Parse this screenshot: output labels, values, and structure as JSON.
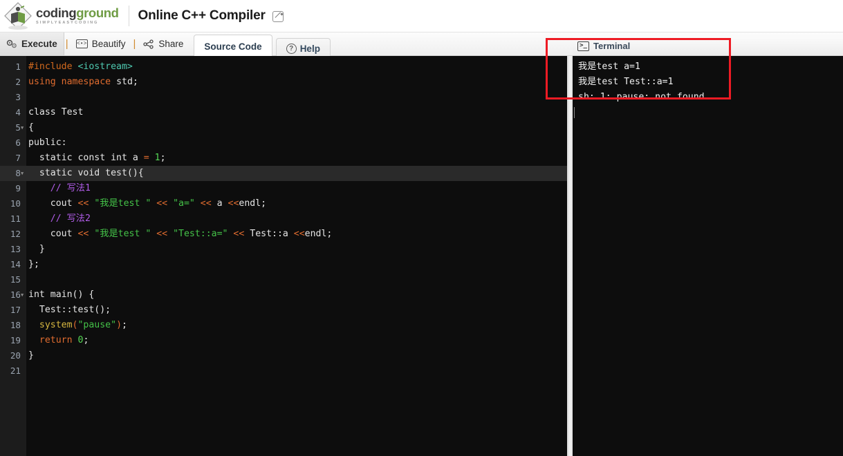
{
  "header": {
    "logo_main_part1": "coding",
    "logo_main_part2": "ground",
    "logo_tagline": "SIMPLYEASYCODING",
    "app_title": "Online C++ Compiler",
    "edit_icon": "pencil-edit-icon"
  },
  "toolbar": {
    "execute_label": "Execute",
    "execute_icon": "gears-icon",
    "separator": "|",
    "beautify_label": "Beautify",
    "beautify_icon": "monitor-code-icon",
    "share_label": "Share",
    "share_icon": "share-nodes-icon",
    "tabs": [
      {
        "label": "Source Code",
        "active": true,
        "icon": ""
      },
      {
        "label": "Help",
        "active": false,
        "icon": "question-circle-icon"
      }
    ],
    "help_glyph": "?"
  },
  "editor": {
    "language": "cpp",
    "active_line": 8,
    "lines": [
      {
        "n": "1",
        "fold": false,
        "tokens": [
          {
            "t": "#include ",
            "c": "t-pre"
          },
          {
            "t": "<iostream>",
            "c": "t-inc"
          }
        ]
      },
      {
        "n": "2",
        "fold": false,
        "tokens": [
          {
            "t": "using",
            "c": "t-kw"
          },
          {
            "t": " ",
            "c": "t-plain"
          },
          {
            "t": "namespace",
            "c": "t-kw"
          },
          {
            "t": " std;",
            "c": "t-plain"
          }
        ]
      },
      {
        "n": "3",
        "fold": false,
        "tokens": []
      },
      {
        "n": "4",
        "fold": false,
        "tokens": [
          {
            "t": "class Test",
            "c": "t-plain"
          }
        ]
      },
      {
        "n": "5",
        "fold": true,
        "tokens": [
          {
            "t": "{",
            "c": "t-plain"
          }
        ]
      },
      {
        "n": "6",
        "fold": false,
        "tokens": [
          {
            "t": "public:",
            "c": "t-plain"
          }
        ]
      },
      {
        "n": "7",
        "fold": false,
        "tokens": [
          {
            "t": "  static const int a ",
            "c": "t-plain"
          },
          {
            "t": "=",
            "c": "t-op"
          },
          {
            "t": " ",
            "c": "t-plain"
          },
          {
            "t": "1",
            "c": "t-num"
          },
          {
            "t": ";",
            "c": "t-plain"
          }
        ]
      },
      {
        "n": "8",
        "fold": true,
        "tokens": [
          {
            "t": "  static void test(){",
            "c": "t-plain"
          }
        ]
      },
      {
        "n": "9",
        "fold": false,
        "tokens": [
          {
            "t": "    // 写法1",
            "c": "t-com"
          }
        ]
      },
      {
        "n": "10",
        "fold": false,
        "tokens": [
          {
            "t": "    cout ",
            "c": "t-plain"
          },
          {
            "t": "<<",
            "c": "t-op"
          },
          {
            "t": " ",
            "c": "t-plain"
          },
          {
            "t": "\"我是test \"",
            "c": "t-str"
          },
          {
            "t": " ",
            "c": "t-plain"
          },
          {
            "t": "<<",
            "c": "t-op"
          },
          {
            "t": " ",
            "c": "t-plain"
          },
          {
            "t": "\"a=\"",
            "c": "t-str"
          },
          {
            "t": " ",
            "c": "t-plain"
          },
          {
            "t": "<<",
            "c": "t-op"
          },
          {
            "t": " a ",
            "c": "t-plain"
          },
          {
            "t": "<<",
            "c": "t-op"
          },
          {
            "t": "endl;",
            "c": "t-plain"
          }
        ]
      },
      {
        "n": "11",
        "fold": false,
        "tokens": [
          {
            "t": "    // 写法2",
            "c": "t-com"
          }
        ]
      },
      {
        "n": "12",
        "fold": false,
        "tokens": [
          {
            "t": "    cout ",
            "c": "t-plain"
          },
          {
            "t": "<<",
            "c": "t-op"
          },
          {
            "t": " ",
            "c": "t-plain"
          },
          {
            "t": "\"我是test \"",
            "c": "t-str"
          },
          {
            "t": " ",
            "c": "t-plain"
          },
          {
            "t": "<<",
            "c": "t-op"
          },
          {
            "t": " ",
            "c": "t-plain"
          },
          {
            "t": "\"Test::a=\"",
            "c": "t-str"
          },
          {
            "t": " ",
            "c": "t-plain"
          },
          {
            "t": "<<",
            "c": "t-op"
          },
          {
            "t": " Test::a ",
            "c": "t-plain"
          },
          {
            "t": "<<",
            "c": "t-op"
          },
          {
            "t": "endl;",
            "c": "t-plain"
          }
        ]
      },
      {
        "n": "13",
        "fold": false,
        "tokens": [
          {
            "t": "  }",
            "c": "t-plain"
          }
        ]
      },
      {
        "n": "14",
        "fold": false,
        "tokens": [
          {
            "t": "};",
            "c": "t-plain"
          }
        ]
      },
      {
        "n": "15",
        "fold": false,
        "tokens": []
      },
      {
        "n": "16",
        "fold": true,
        "tokens": [
          {
            "t": "int main() {",
            "c": "t-plain"
          }
        ]
      },
      {
        "n": "17",
        "fold": false,
        "tokens": [
          {
            "t": "  Test::test();",
            "c": "t-plain"
          }
        ]
      },
      {
        "n": "18",
        "fold": false,
        "tokens": [
          {
            "t": "  ",
            "c": "t-plain"
          },
          {
            "t": "system",
            "c": "t-fn"
          },
          {
            "t": "(",
            "c": "t-op"
          },
          {
            "t": "\"pause\"",
            "c": "t-str"
          },
          {
            "t": ")",
            "c": "t-op"
          },
          {
            "t": ";",
            "c": "t-plain"
          }
        ]
      },
      {
        "n": "19",
        "fold": false,
        "tokens": [
          {
            "t": "  ",
            "c": "t-plain"
          },
          {
            "t": "return",
            "c": "t-kw"
          },
          {
            "t": " ",
            "c": "t-plain"
          },
          {
            "t": "0",
            "c": "t-num"
          },
          {
            "t": ";",
            "c": "t-plain"
          }
        ]
      },
      {
        "n": "20",
        "fold": false,
        "tokens": [
          {
            "t": "}",
            "c": "t-plain"
          }
        ]
      },
      {
        "n": "21",
        "fold": false,
        "tokens": []
      }
    ]
  },
  "terminal": {
    "title": "Terminal",
    "icon": "terminal-prompt-icon",
    "icon_glyph": ">_",
    "output": "我是test a=1\n我是test Test::a=1\nsh: 1: pause: not found"
  },
  "annotation": {
    "type": "rectangle-highlight",
    "color": "#ee1b24"
  }
}
